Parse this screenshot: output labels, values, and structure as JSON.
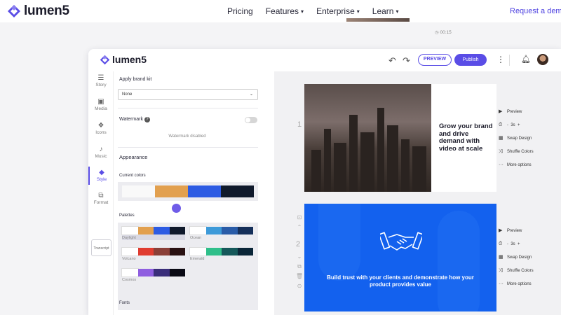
{
  "site": {
    "brand": "lumen5",
    "nav": [
      {
        "label": "Pricing",
        "has_caret": false
      },
      {
        "label": "Features",
        "has_caret": true
      },
      {
        "label": "Enterprise",
        "has_caret": true
      },
      {
        "label": "Learn",
        "has_caret": true
      }
    ],
    "request_demo": "Request a dem"
  },
  "app": {
    "brand": "lumen5",
    "preview_label": "PREVIEW",
    "publish_label": "Publish",
    "timer": "00:15"
  },
  "rail": {
    "items": [
      "Story",
      "Media",
      "Icons",
      "Music",
      "Style",
      "Format"
    ],
    "active": "Style",
    "transcript": "Transcript"
  },
  "panel": {
    "brand_kit_label": "Apply brand kit",
    "brand_kit_value": "None",
    "watermark_label": "Watermark",
    "watermark_note": "Watermark disabled",
    "appearance_label": "Appearance",
    "current_colors_label": "Current colors",
    "current_colors": [
      "#f9f9f9",
      "#e2a04f",
      "#2d5be3",
      "#101a2c"
    ],
    "palettes_label": "Palettes",
    "palettes": [
      {
        "name": "Daylight",
        "colors": [
          "#ffffff",
          "#e2a04f",
          "#2d5be3",
          "#101a2c"
        ]
      },
      {
        "name": "Ocean",
        "colors": [
          "#ffffff",
          "#3d9ad9",
          "#2a5ca8",
          "#16305a"
        ]
      },
      {
        "name": "Volcano",
        "colors": [
          "#ffffff",
          "#e03c30",
          "#8a3f38",
          "#2a1212"
        ]
      },
      {
        "name": "Emerald",
        "colors": [
          "#ffffff",
          "#2fbf8a",
          "#15585a",
          "#0b2638"
        ]
      },
      {
        "name": "Cosmos",
        "colors": [
          "#ffffff",
          "#8f5ee0",
          "#3a2e7a",
          "#0a0a14"
        ]
      }
    ],
    "fonts_label": "Fonts"
  },
  "slides": [
    {
      "number": "1",
      "text": "Grow your brand and drive demand with video at scale"
    },
    {
      "number": "2",
      "text": "Build trust with your clients and demonstrate how your product provides value"
    }
  ],
  "slide_menu": {
    "preview": "Preview",
    "duration_minus": "-",
    "duration": "3s",
    "duration_plus": "+",
    "swap_design": "Swap Design",
    "shuffle_colors": "Shuffle Colors",
    "more_options": "More options"
  },
  "colors": {
    "accent": "#5a4de6",
    "slide2_bg": "#1361ee"
  }
}
